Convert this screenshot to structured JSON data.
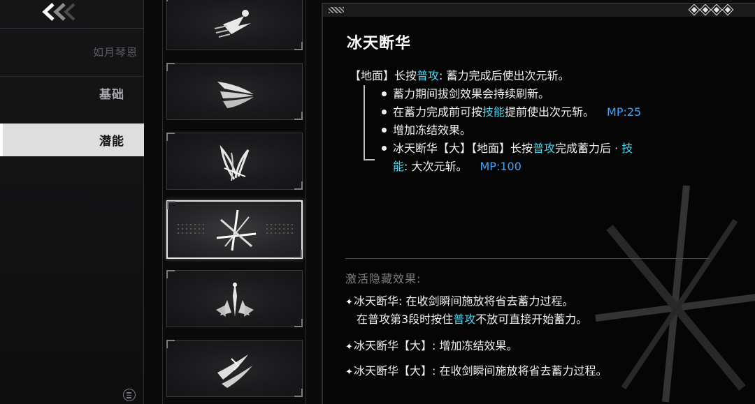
{
  "nav": {
    "character_name": "如月琴恩",
    "items": [
      {
        "label": "基础"
      },
      {
        "label": "潜能"
      }
    ]
  },
  "detail": {
    "title": "冰天断华",
    "lines": {
      "l1": {
        "a": "【地面】长按",
        "hl": "普攻",
        "b": ": 蓄力完成后使出次元斩。"
      },
      "l2": "蓄力期间拔剑效果会持续刷新。",
      "l3": {
        "a": "在蓄力完成前可按",
        "hl": "技能",
        "b": "提前使出次元斩。",
        "mp": "MP:25"
      },
      "l4": "增加冻结效果。",
      "l5": {
        "a": "冰天断华【大】【地面】长按",
        "hl": "普攻",
        "b": "完成蓄力后 · ",
        "hl2": "技"
      },
      "l6": {
        "hl": "能",
        "b": ": 大次元斩。",
        "mp": "MP:100"
      }
    },
    "hidden_title": "激活隐藏效果:",
    "hidden": {
      "h1": "冰天断华: 在收剑瞬间施放将省去蓄力过程。",
      "h1b": {
        "a": "在普攻第3段时按住",
        "hl": "普攻",
        "b": "不放可直接开始蓄力。"
      },
      "h2": "冰天断华【大】: 增加冻结效果。",
      "h3": "冰天断华【大】: 在收剑瞬间施放将省去蓄力过程。"
    }
  },
  "colors": {
    "highlight": "#46d7ef",
    "mp": "#3ea6ff",
    "selected_tab": "#dedede"
  },
  "icons": [
    "back-chevrons-icon",
    "menu-icon",
    "skill-dash-icon",
    "skill-wing-icon",
    "skill-feather-icon",
    "skill-cross-slash-icon",
    "skill-ice-burst-icon",
    "skill-claw-icon"
  ]
}
